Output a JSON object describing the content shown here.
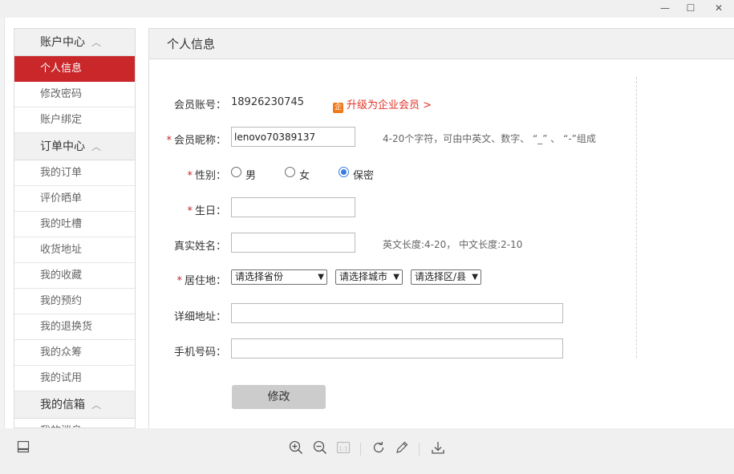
{
  "window": {
    "minimize": "—",
    "maximize": "☐",
    "close": "✕"
  },
  "sidebar": {
    "sections": [
      {
        "title": "账户中心",
        "items": [
          "个人信息",
          "修改密码",
          "账户绑定"
        ]
      },
      {
        "title": "订单中心",
        "items": [
          "我的订单",
          "评价晒单",
          "我的吐槽",
          "收货地址",
          "我的收藏",
          "我的预约",
          "我的退换货",
          "我的众筹",
          "我的试用"
        ]
      },
      {
        "title": "我的信箱",
        "items": [
          "我的消息"
        ]
      }
    ],
    "active_item": "个人信息",
    "chevron": "^"
  },
  "content": {
    "title": "个人信息",
    "account": {
      "label": "会员账号：",
      "value": "18926230745",
      "upgrade_icon": "企",
      "upgrade_text": "升级为企业会员 >"
    },
    "nickname": {
      "required": "*",
      "label": "会员昵称：",
      "value": "lenovo70389137",
      "hint": "4-20个字符，可由中英文、数字、 “_” 、 “-”组成"
    },
    "gender": {
      "required": "*",
      "label": "性别：",
      "options": [
        "男",
        "女",
        "保密"
      ],
      "selected": "保密"
    },
    "birthday": {
      "required": "*",
      "label": "生日：",
      "value": ""
    },
    "realname": {
      "label": "真实姓名：",
      "value": "",
      "hint": "英文长度:4-20， 中文长度:2-10"
    },
    "residence": {
      "required": "*",
      "label": "居住地：",
      "province": "请选择省份",
      "city": "请选择城市",
      "district": "请选择区/县"
    },
    "address": {
      "label": "详细地址：",
      "value": ""
    },
    "phone": {
      "label": "手机号码：",
      "value": ""
    },
    "submit": "修改"
  },
  "toolbar": {
    "page_box": "1:1"
  },
  "colors": {
    "accent": "#c9272a",
    "upgrade": "#e0362a",
    "radio_selected": "#3b7ddd"
  }
}
